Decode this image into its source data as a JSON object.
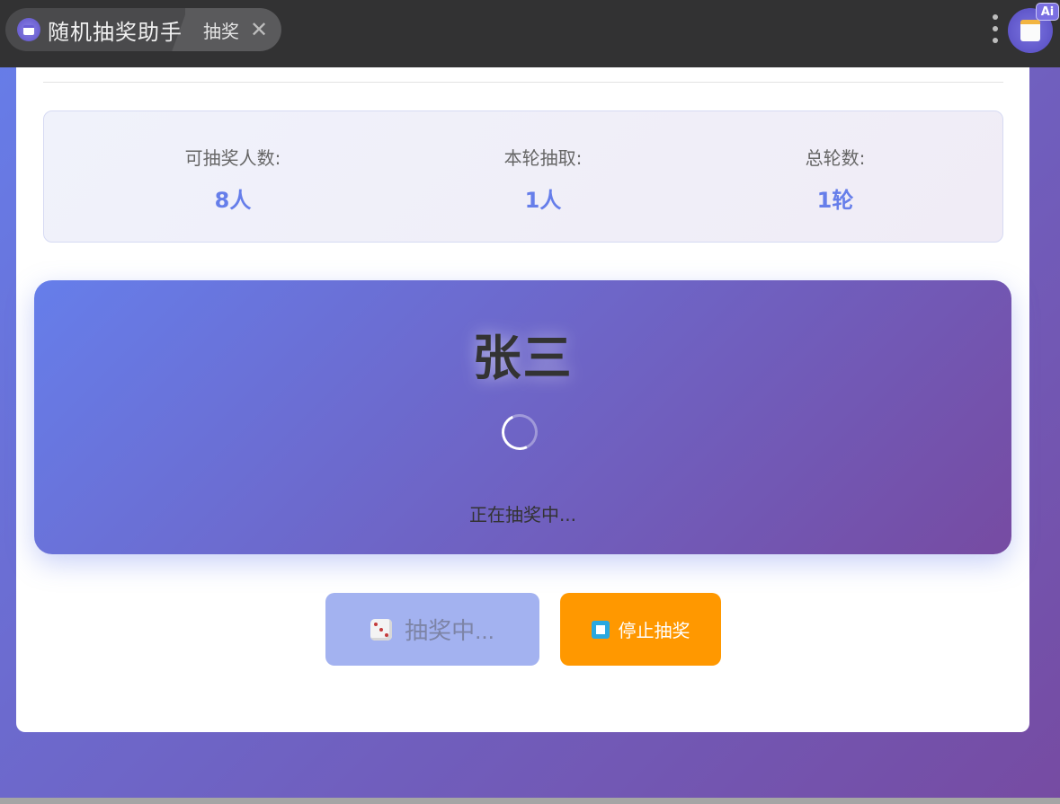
{
  "tabs": {
    "app_title": "随机抽奖助手",
    "sub_tab_label": "抽奖",
    "close_glyph": "✕"
  },
  "badge": {
    "ai": "Ai"
  },
  "stats": [
    {
      "label": "可抽奖人数:",
      "value": "8人"
    },
    {
      "label": "本轮抽取:",
      "value": "1人"
    },
    {
      "label": "总轮数:",
      "value": "1轮"
    }
  ],
  "draw": {
    "winner": "张三",
    "status": "正在抽奖中..."
  },
  "buttons": {
    "draw_label": "抽奖中...",
    "stop_label": "停止抽奖"
  },
  "icons": [
    "app-calendar-icon",
    "close-icon",
    "more-vertical-icon",
    "assistant-avatar-icon",
    "dice-icon",
    "stop-icon",
    "loading-spinner-icon"
  ],
  "colors": {
    "accent": "#667eea",
    "gradient_end": "#764ba2",
    "stop_button": "#ff9800",
    "draw_button_disabled": "#a3b2f0"
  }
}
